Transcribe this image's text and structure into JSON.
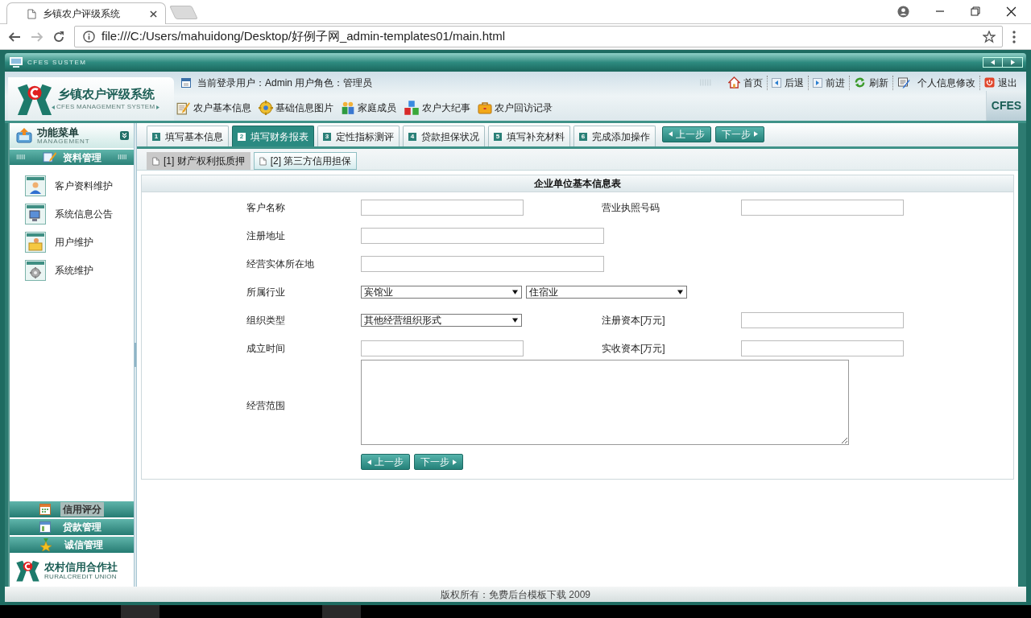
{
  "browser": {
    "tab_title": "乡镇农户评级系统",
    "address": "file:///C:/Users/mahuidong/Desktop/好例子网_admin-templates01/main.html"
  },
  "app": {
    "system_label": "CFES SUSTEM",
    "title": "乡镇农户评级系统",
    "subtitle": "CFES MANAGEMENT SYSTEM",
    "user_info": "当前登录用户：Admin 用户角色：管理员",
    "nav_links": [
      {
        "kind": "home",
        "label": "首页"
      },
      {
        "kind": "back",
        "label": "后退"
      },
      {
        "kind": "forward",
        "label": "前进"
      },
      {
        "kind": "refresh",
        "label": "刷新"
      },
      {
        "kind": "profile",
        "label": "个人信息修改"
      },
      {
        "kind": "exit",
        "label": "退出"
      }
    ],
    "modules": [
      {
        "kind": "basic",
        "label": "农户基本信息"
      },
      {
        "kind": "images",
        "label": "基础信息图片"
      },
      {
        "kind": "family",
        "label": "家庭成员"
      },
      {
        "kind": "events",
        "label": "农户大纪事"
      },
      {
        "kind": "visits",
        "label": "农户回访记录"
      }
    ],
    "brand": "CFES"
  },
  "sidebar": {
    "title": "功能菜单",
    "subtitle": "MANAGEMENT",
    "section": "资料管理",
    "items": [
      {
        "kind": "customer",
        "label": "客户资料维护"
      },
      {
        "kind": "notice",
        "label": "系统信息公告"
      },
      {
        "kind": "user",
        "label": "用户维护"
      },
      {
        "kind": "system",
        "label": "系统维护"
      }
    ],
    "groups": [
      {
        "kind": "credit",
        "label": "信用评分",
        "selected": true
      },
      {
        "kind": "loan",
        "label": "贷款管理",
        "selected": false
      },
      {
        "kind": "integrity",
        "label": "诚信管理",
        "selected": false
      }
    ],
    "logo": {
      "name": "农村信用合作社",
      "subtitle": "RURALCREDIT UNION"
    }
  },
  "steps": {
    "tabs": [
      {
        "number": "1",
        "label": "填写基本信息",
        "selected": false
      },
      {
        "number": "2",
        "label": "填写财务报表",
        "selected": true
      },
      {
        "number": "3",
        "label": "定性指标测评",
        "selected": false
      },
      {
        "number": "4",
        "label": "贷款担保状况",
        "selected": false
      },
      {
        "number": "5",
        "label": "填写补充材料",
        "selected": false
      },
      {
        "number": "6",
        "label": "完成添加操作",
        "selected": false
      }
    ],
    "prev": "上一步",
    "next": "下一步"
  },
  "subtabs": [
    {
      "label": "[1] 财产权利抵质押",
      "selected": false
    },
    {
      "label": "[2] 第三方信用担保",
      "selected": true
    }
  ],
  "form": {
    "title": "企业单位基本信息表",
    "rows": [
      [
        {
          "label": "客户名称",
          "kind": "input"
        },
        {
          "label": "营业执照号码",
          "kind": "input"
        }
      ],
      [
        {
          "label": "注册地址",
          "kind": "wide_input"
        }
      ],
      [
        {
          "label": "经营实体所在地",
          "kind": "wide_input"
        }
      ],
      [
        {
          "label": "所属行业",
          "kind": "selects",
          "values": [
            "宾馆业",
            "住宿业"
          ]
        }
      ],
      [
        {
          "label": "组织类型",
          "kind": "selects",
          "values": [
            "其他经营组织形式"
          ]
        },
        {
          "label": "注册资本[万元]",
          "kind": "input"
        }
      ],
      [
        {
          "label": "成立时间",
          "kind": "input"
        },
        {
          "label": "实收资本[万元]",
          "kind": "input"
        }
      ],
      [
        {
          "label": "经营范围",
          "kind": "textarea"
        }
      ]
    ],
    "prev": "上一步",
    "next": "下一步"
  },
  "footer": {
    "copyright": "版权所有：免费后台模板下载 2009"
  }
}
